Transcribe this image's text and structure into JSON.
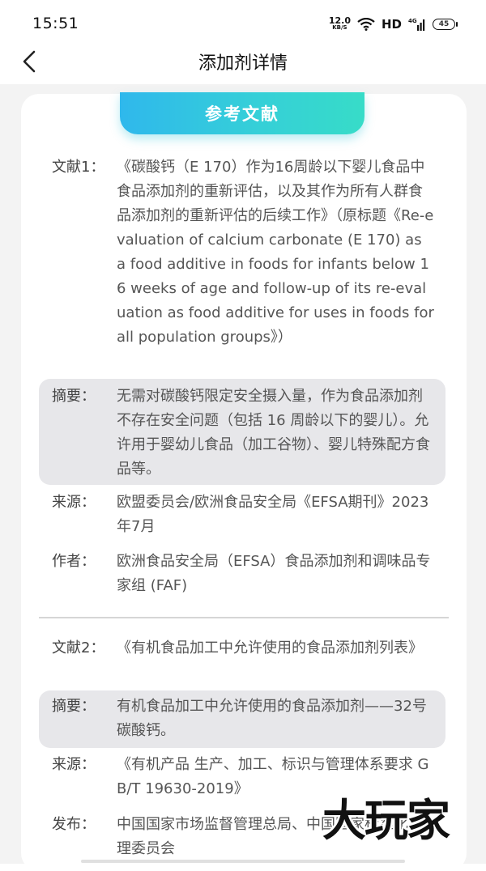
{
  "status_bar": {
    "time": "15:51",
    "net_speed_value": "12.0",
    "net_speed_unit": "KB/S",
    "hd": "HD",
    "network": "4G",
    "battery": "45"
  },
  "nav": {
    "title": "添加剂详情"
  },
  "section": {
    "title": "参考文献"
  },
  "references": [
    {
      "label": "文献1：",
      "title": "《碳酸钙（E 170）作为16周龄以下婴儿食品中食品添加剂的重新评估，以及其作为所有人群食品添加剂的重新评估的后续工作》（原标题《Re-evaluation of calcium carbonate (E 170) as a food additive in foods for infants below 16 weeks of age and follow-up of its re-evaluation as food additive for uses in foods for all population groups》）",
      "summary_label": "摘要：",
      "summary": "无需对碳酸钙限定安全摄入量，作为食品添加剂不存在安全问题（包括 16 周龄以下的婴儿）。允许用于婴幼儿食品（加工谷物）、婴儿特殊配方食品等。",
      "source_label": "来源：",
      "source": "欧盟委员会/欧洲食品安全局《EFSA期刊》2023年7月",
      "author_label": "作者：",
      "author": "欧洲食品安全局（EFSA）食品添加剂和调味品专家组 (FAF)"
    },
    {
      "label": "文献2：",
      "title": "《有机食品加工中允许使用的食品添加剂列表》",
      "summary_label": "摘要：",
      "summary": "有机食品加工中允许使用的食品添加剂——32号 碳酸钙。",
      "source_label": "来源：",
      "source": "《有机产品 生产、加工、标识与管理体系要求 GB/T 19630-2019》",
      "publisher_label": "发布：",
      "publisher": "中国国家市场监督管理总局、中国国家标准化管理委员会"
    }
  ],
  "watermark": "大玩家"
}
